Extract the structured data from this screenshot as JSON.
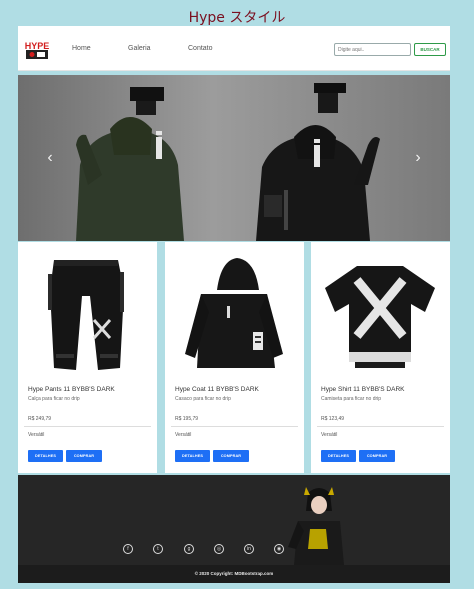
{
  "header": {
    "title": "Hype スタイル"
  },
  "navbar": {
    "logo_text": "HYPE",
    "links": [
      "Home",
      "Galeria",
      "Contato"
    ],
    "search": {
      "placeholder": "Digite aqui..",
      "button_label": "BUSCAR"
    }
  },
  "carousel": {
    "slide_count": 3,
    "active_index": 1
  },
  "products": [
    {
      "title": "Hype Pants 11 BYBB'S DARK",
      "description": "Calça para ficar no drip",
      "price": "R$ 249,79",
      "tag": "Versátil",
      "details_label": "DETALHES",
      "buy_label": "COMPRAR"
    },
    {
      "title": "Hype Coat 11 BYBB'S DARK",
      "description": "Casaco para ficar no drip",
      "price": "R$ 195,79",
      "tag": "Versátil",
      "details_label": "DETALHES",
      "buy_label": "COMPRAR"
    },
    {
      "title": "Hype Shirt 11 BYBB'S DARK",
      "description": "Camiseta para ficar no drip",
      "price": "R$ 123,49",
      "tag": "Versátil",
      "details_label": "DETALHES",
      "buy_label": "COMPRAR"
    }
  ],
  "footer": {
    "social_icons": [
      "facebook-icon",
      "twitter-icon",
      "google-icon",
      "instagram-icon",
      "linkedin-icon",
      "github-icon"
    ],
    "copyright": "© 2020 Copyright: MDBootstrap.com"
  },
  "colors": {
    "page_bg": "#b0dde4",
    "title": "#7a1020",
    "button": "#1e6ff5",
    "search_button": "#2e9a48",
    "footer": "#262626"
  }
}
